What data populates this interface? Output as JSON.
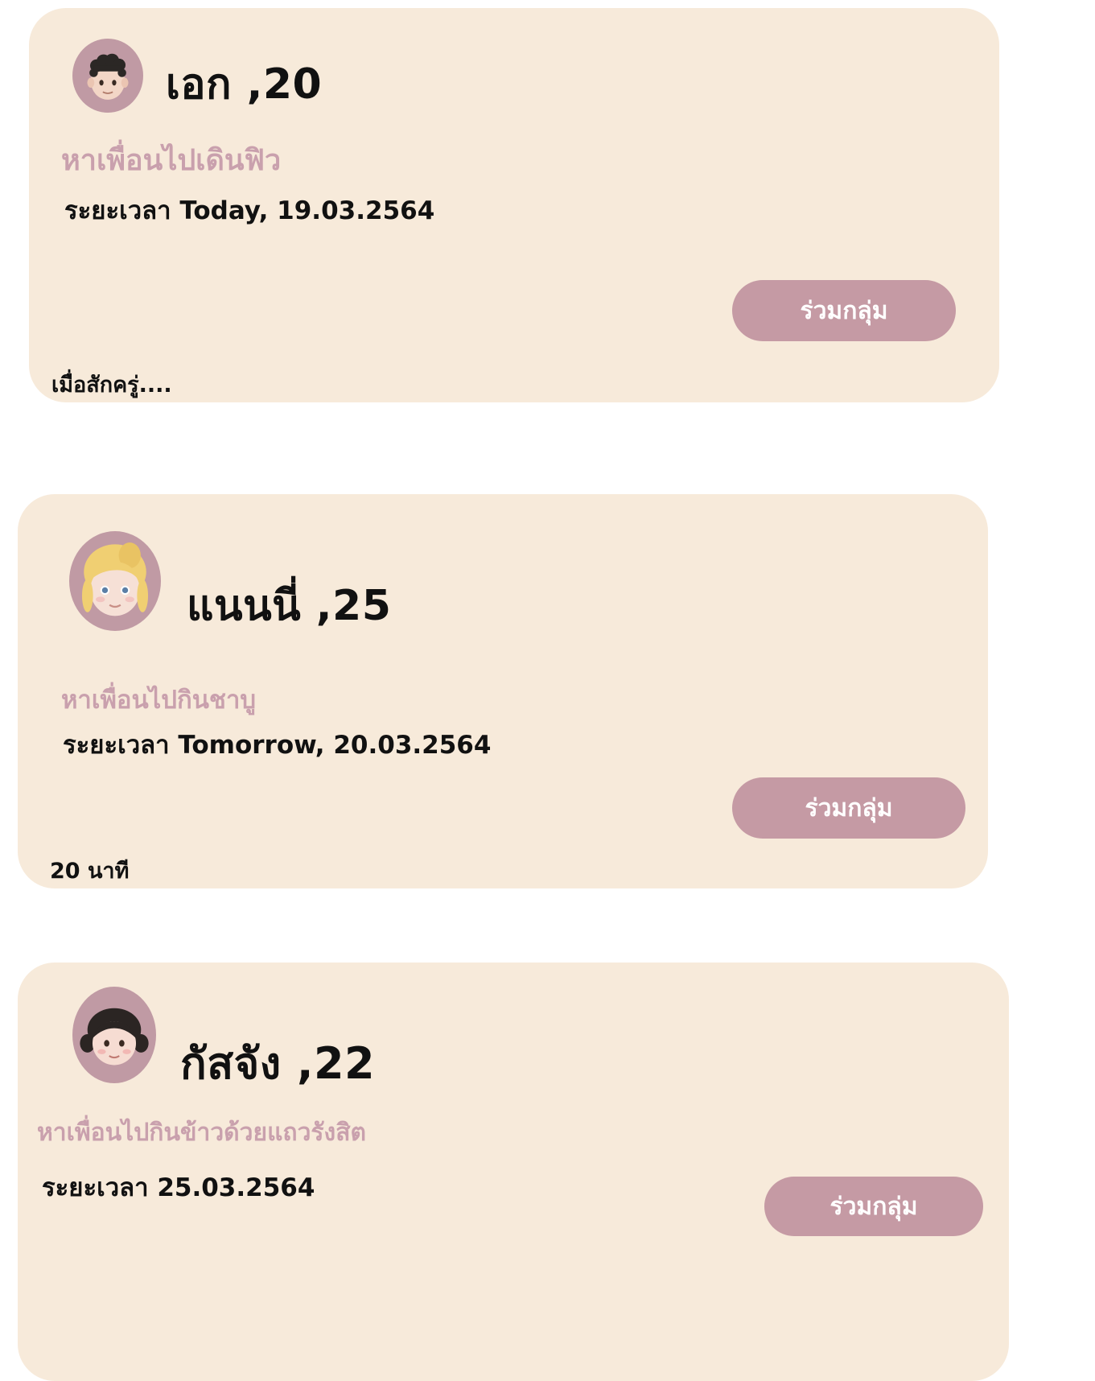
{
  "posts": [
    {
      "name": "เอก ,20",
      "activity": "หาเพื่อนไปเดินฟิว",
      "time": "ระยะเวลา Today, 19.03.2564",
      "join_label": "ร่วมกลุ่ม",
      "posted_ago": "เมื่อสักครู่....",
      "avatar_icon": "boy-emoji-icon"
    },
    {
      "name": "แนนนี่ ,25",
      "activity": "หาเพื่อนไปกินชาบู",
      "time": "ระยะเวลา Tomorrow, 20.03.2564",
      "join_label": "ร่วมกลุ่ม",
      "posted_ago": "20 นาที",
      "avatar_icon": "blonde-woman-emoji-icon"
    },
    {
      "name": "กัสจัง ,22",
      "activity": "หาเพื่อนไปกินข้าวด้วยแถวรังสิต",
      "time": "ระยะเวลา 25.03.2564",
      "join_label": "ร่วมกลุ่ม",
      "avatar_icon": "girl-emoji-icon"
    }
  ],
  "colors": {
    "card_bg": "#f7eada",
    "accent": "#c59aa4",
    "subtitle": "#c9a0ad"
  }
}
